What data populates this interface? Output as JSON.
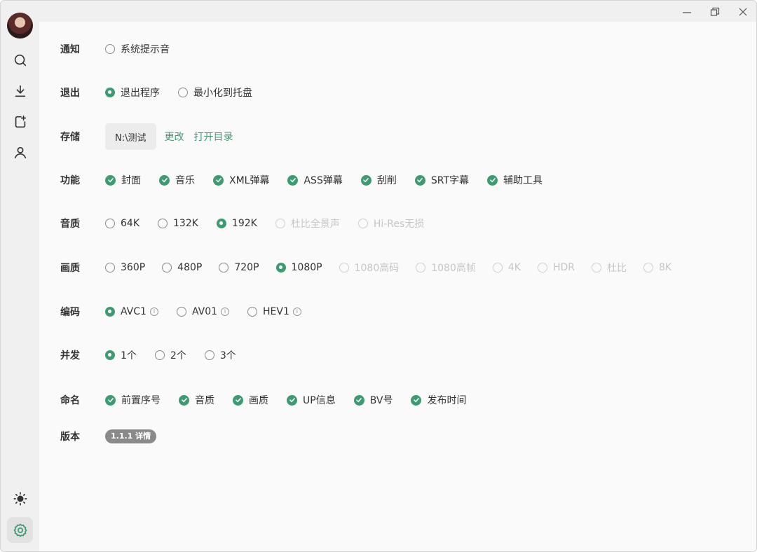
{
  "window": {
    "minimize_icon": "minimize-icon",
    "restore_icon": "restore-icon",
    "close_icon": "close-icon"
  },
  "sidebar": {
    "items": [
      {
        "name": "search",
        "icon": "search-icon"
      },
      {
        "name": "download",
        "icon": "download-icon"
      },
      {
        "name": "add-task",
        "icon": "add-file-icon"
      },
      {
        "name": "user",
        "icon": "user-icon"
      }
    ],
    "bottom": [
      {
        "name": "theme",
        "icon": "sun-icon"
      },
      {
        "name": "settings",
        "icon": "gear-icon",
        "active": true
      }
    ]
  },
  "settings": {
    "notify": {
      "label": "通知",
      "options": [
        {
          "text": "系统提示音",
          "selected": false
        }
      ]
    },
    "exit": {
      "label": "退出",
      "options": [
        {
          "text": "退出程序",
          "selected": true
        },
        {
          "text": "最小化到托盘",
          "selected": false
        }
      ]
    },
    "storage": {
      "label": "存储",
      "path": "N:\\测试",
      "change_link": "更改",
      "open_link": "打开目录"
    },
    "features": {
      "label": "功能",
      "options": [
        {
          "text": "封面",
          "checked": true
        },
        {
          "text": "音乐",
          "checked": true
        },
        {
          "text": "XML弹幕",
          "checked": true
        },
        {
          "text": "ASS弹幕",
          "checked": true
        },
        {
          "text": "刮削",
          "checked": true
        },
        {
          "text": "SRT字幕",
          "checked": true
        },
        {
          "text": "辅助工具",
          "checked": true
        }
      ]
    },
    "audio": {
      "label": "音质",
      "options": [
        {
          "text": "64K",
          "selected": false
        },
        {
          "text": "132K",
          "selected": false
        },
        {
          "text": "192K",
          "selected": true
        },
        {
          "text": "杜比全景声",
          "selected": false,
          "disabled": true
        },
        {
          "text": "Hi-Res无损",
          "selected": false,
          "disabled": true
        }
      ]
    },
    "video": {
      "label": "画质",
      "options": [
        {
          "text": "360P",
          "selected": false
        },
        {
          "text": "480P",
          "selected": false
        },
        {
          "text": "720P",
          "selected": false
        },
        {
          "text": "1080P",
          "selected": true
        },
        {
          "text": "1080高码",
          "selected": false,
          "disabled": true
        },
        {
          "text": "1080高帧",
          "selected": false,
          "disabled": true
        },
        {
          "text": "4K",
          "selected": false,
          "disabled": true
        },
        {
          "text": "HDR",
          "selected": false,
          "disabled": true
        },
        {
          "text": "杜比",
          "selected": false,
          "disabled": true
        },
        {
          "text": "8K",
          "selected": false,
          "disabled": true
        }
      ]
    },
    "codec": {
      "label": "编码",
      "info_glyph": "i",
      "options": [
        {
          "text": "AVC1",
          "selected": true
        },
        {
          "text": "AV01",
          "selected": false
        },
        {
          "text": "HEV1",
          "selected": false
        }
      ]
    },
    "concurrency": {
      "label": "并发",
      "options": [
        {
          "text": "1个",
          "selected": true
        },
        {
          "text": "2个",
          "selected": false
        },
        {
          "text": "3个",
          "selected": false
        }
      ]
    },
    "naming": {
      "label": "命名",
      "options": [
        {
          "text": "前置序号",
          "checked": true
        },
        {
          "text": "音质",
          "checked": true
        },
        {
          "text": "画质",
          "checked": true
        },
        {
          "text": "UP信息",
          "checked": true
        },
        {
          "text": "BV号",
          "checked": true
        },
        {
          "text": "发布时间",
          "checked": true
        }
      ]
    },
    "version": {
      "label": "版本",
      "badge": "1.1.1 详情"
    }
  },
  "colors": {
    "accent": "#3e9a73",
    "disabled": "#c6c6c6"
  }
}
